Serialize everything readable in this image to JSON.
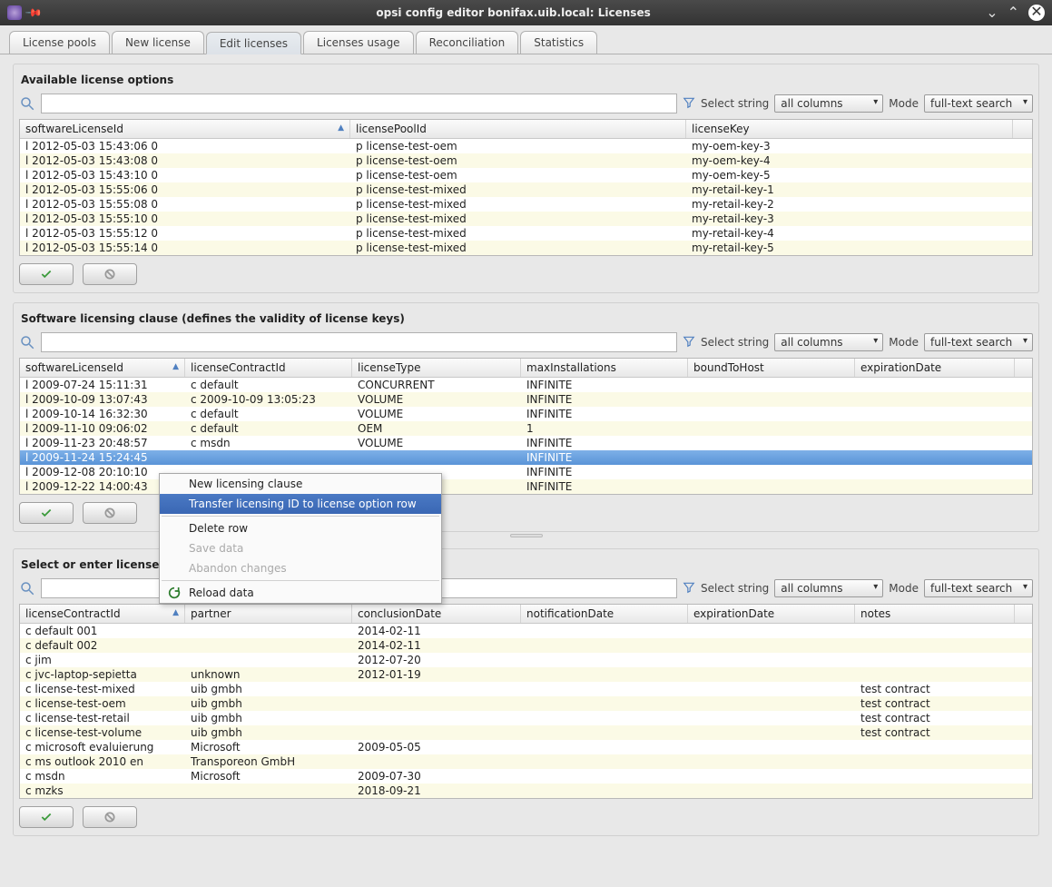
{
  "title": "opsi config editor bonifax.uib.local: Licenses",
  "tabs": [
    "License pools",
    "New license",
    "Edit licenses",
    "Licenses usage",
    "Reconciliation",
    "Statistics"
  ],
  "active_tab": 2,
  "filter": {
    "select_string": "Select string",
    "all_columns": "all columns",
    "mode": "Mode",
    "fulltext": "full-text search"
  },
  "panel1": {
    "title": "Available license options",
    "cols": [
      "softwareLicenseId",
      "licensePoolId",
      "licenseKey"
    ],
    "rows": [
      {
        "a": "l 2012-05-03 15:43:06 0",
        "b": "p license-test-oem",
        "c": "my-oem-key-3"
      },
      {
        "a": "l 2012-05-03 15:43:08 0",
        "b": "p license-test-oem",
        "c": "my-oem-key-4"
      },
      {
        "a": "l 2012-05-03 15:43:10 0",
        "b": "p license-test-oem",
        "c": "my-oem-key-5"
      },
      {
        "a": "l 2012-05-03 15:55:06 0",
        "b": "p license-test-mixed",
        "c": "my-retail-key-1"
      },
      {
        "a": "l 2012-05-03 15:55:08 0",
        "b": "p license-test-mixed",
        "c": "my-retail-key-2"
      },
      {
        "a": "l 2012-05-03 15:55:10 0",
        "b": "p license-test-mixed",
        "c": "my-retail-key-3"
      },
      {
        "a": "l 2012-05-03 15:55:12 0",
        "b": "p license-test-mixed",
        "c": "my-retail-key-4"
      },
      {
        "a": "l 2012-05-03 15:55:14 0",
        "b": "p license-test-mixed",
        "c": "my-retail-key-5"
      }
    ]
  },
  "panel2": {
    "title": "Software licensing clause (defines the validity of license keys)",
    "cols": [
      "softwareLicenseId",
      "licenseContractId",
      "licenseType",
      "maxInstallations",
      "boundToHost",
      "expirationDate"
    ],
    "rows": [
      {
        "a": "l 2009-07-24 15:11:31",
        "b": "c default",
        "c": "CONCURRENT",
        "d": "INFINITE",
        "e": "",
        "f": ""
      },
      {
        "a": "l 2009-10-09 13:07:43",
        "b": "c 2009-10-09 13:05:23",
        "c": "VOLUME",
        "d": "INFINITE",
        "e": "",
        "f": ""
      },
      {
        "a": "l 2009-10-14 16:32:30",
        "b": "c default",
        "c": "VOLUME",
        "d": "INFINITE",
        "e": "",
        "f": ""
      },
      {
        "a": "l 2009-11-10 09:06:02",
        "b": "c default",
        "c": "OEM",
        "d": "1",
        "e": "",
        "f": ""
      },
      {
        "a": "l 2009-11-23 20:48:57",
        "b": "c msdn",
        "c": "VOLUME",
        "d": "INFINITE",
        "e": "",
        "f": ""
      },
      {
        "a": "l 2009-11-24 15:24:45",
        "b": "",
        "c": "",
        "d": "INFINITE",
        "e": "",
        "f": "",
        "sel": true
      },
      {
        "a": "l 2009-12-08 20:10:10",
        "b": "",
        "c": "",
        "d": "INFINITE",
        "e": "",
        "f": ""
      },
      {
        "a": "l 2009-12-22 14:00:43",
        "b": "",
        "c": "",
        "d": "INFINITE",
        "e": "",
        "f": ""
      }
    ]
  },
  "panel3": {
    "title": "Select or enter license contract",
    "cols": [
      "licenseContractId",
      "partner",
      "conclusionDate",
      "notificationDate",
      "expirationDate",
      "notes"
    ],
    "rows": [
      {
        "a": "c default 001",
        "b": "",
        "c": "2014-02-11",
        "d": "",
        "e": "",
        "f": ""
      },
      {
        "a": "c default 002",
        "b": "",
        "c": "2014-02-11",
        "d": "",
        "e": "",
        "f": ""
      },
      {
        "a": "c jim",
        "b": "",
        "c": "2012-07-20",
        "d": "",
        "e": "",
        "f": ""
      },
      {
        "a": "c jvc-laptop-sepietta",
        "b": "unknown",
        "c": "2012-01-19",
        "d": "",
        "e": "",
        "f": ""
      },
      {
        "a": "c license-test-mixed",
        "b": "uib gmbh",
        "c": "",
        "d": "",
        "e": "",
        "f": "test contract"
      },
      {
        "a": "c license-test-oem",
        "b": "uib gmbh",
        "c": "",
        "d": "",
        "e": "",
        "f": "test contract"
      },
      {
        "a": "c license-test-retail",
        "b": "uib gmbh",
        "c": "",
        "d": "",
        "e": "",
        "f": "test contract"
      },
      {
        "a": "c license-test-volume",
        "b": "uib gmbh",
        "c": "",
        "d": "",
        "e": "",
        "f": "test contract"
      },
      {
        "a": "c microsoft evaluierung",
        "b": "Microsoft",
        "c": "2009-05-05",
        "d": "",
        "e": "",
        "f": ""
      },
      {
        "a": "c ms outlook 2010 en",
        "b": "Transporeon GmbH",
        "c": "",
        "d": "",
        "e": "",
        "f": ""
      },
      {
        "a": "c msdn",
        "b": "Microsoft",
        "c": "2009-07-30",
        "d": "",
        "e": "",
        "f": ""
      },
      {
        "a": "c mzks",
        "b": "",
        "c": "2018-09-21",
        "d": "",
        "e": "",
        "f": ""
      }
    ]
  },
  "ctx": {
    "items": [
      {
        "label": "New licensing clause"
      },
      {
        "label": "Transfer licensing ID to license option row",
        "hover": true
      },
      {
        "sep": true
      },
      {
        "label": "Delete row"
      },
      {
        "label": "Save data",
        "disabled": true
      },
      {
        "label": "Abandon changes",
        "disabled": true
      },
      {
        "sep": true
      },
      {
        "label": "Reload data",
        "icon": "reload"
      }
    ]
  }
}
